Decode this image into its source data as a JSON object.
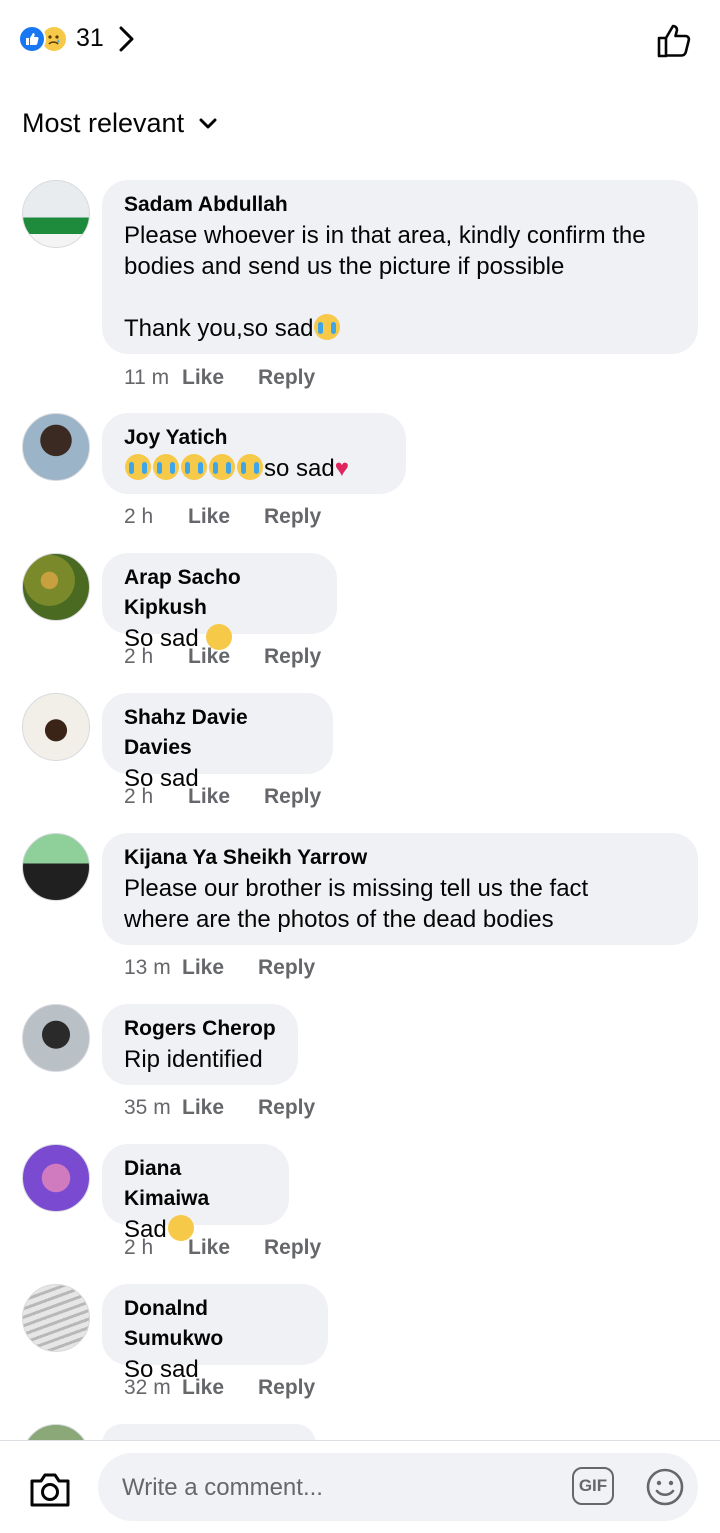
{
  "header": {
    "reaction_count": "31"
  },
  "sort": {
    "label": "Most relevant"
  },
  "comments": [
    {
      "name": "Sadam Abdullah",
      "text": "Please whoever is in that area, kindly confirm the\nbodies and send us the picture if possible\n\nThank you,so sad",
      "emoji": "loudly-crying-face",
      "time": "11 m"
    },
    {
      "name": "Joy Yatich",
      "text": "so sad",
      "emoji": "loudly-crying-face x5, broken-heart",
      "time": "2 h"
    },
    {
      "name": "Arap Sacho Kipkush",
      "text": "So sad",
      "emoji": "pensive-face",
      "time": "2 h"
    },
    {
      "name": "Shahz Davie Davies",
      "text": "So sad",
      "time": "2 h"
    },
    {
      "name": "Kijana Ya Sheikh Yarrow",
      "text": "Please our brother is missing tell us the fact\nwhere are the photos of the dead bodies",
      "time": "13 m"
    },
    {
      "name": "Rogers Cherop",
      "text": "Rip identified",
      "time": "35 m"
    },
    {
      "name": "Diana Kimaiwa",
      "text": "Sad",
      "emoji": "crying-face",
      "time": "2 h"
    },
    {
      "name": "Donalnd Sumukwo",
      "text": "So sad",
      "time": "32 m"
    }
  ],
  "actions": {
    "like": "Like",
    "reply": "Reply"
  },
  "composer": {
    "placeholder": "Write a comment...",
    "gif_label": "GIF"
  },
  "colors": {
    "accent": "#1877f2",
    "bubble": "#eff1f4",
    "meta": "#65676b"
  }
}
